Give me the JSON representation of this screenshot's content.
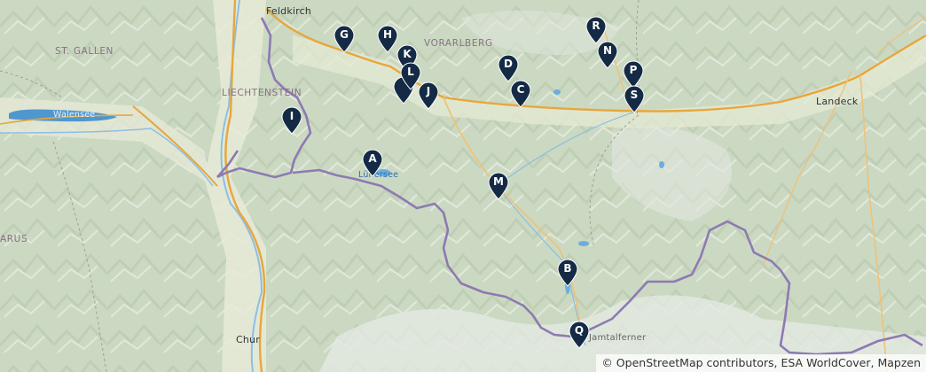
{
  "map": {
    "labels": {
      "feldkirch": "Feldkirch",
      "st_gallen": "ST. GALLEN",
      "liechtenstein": "LIECHTENSTEIN",
      "walensee": "Walensee",
      "vorarlberg": "VORARLBERG",
      "landeck": "Landeck",
      "luenersee": "Lünersee",
      "chur": "Chur",
      "glarus": "ARUS",
      "jamtalferner": "Jamtalferner"
    },
    "markers": [
      "A",
      "B",
      "C",
      "D",
      "G",
      "H",
      "I",
      "J",
      "K",
      "L",
      "M",
      "N",
      "P",
      "Q",
      "R",
      "S"
    ],
    "marker_color": "#142a45",
    "attribution": "© OpenStreetMap contributors, ESA WorldCover, Mapzen"
  }
}
